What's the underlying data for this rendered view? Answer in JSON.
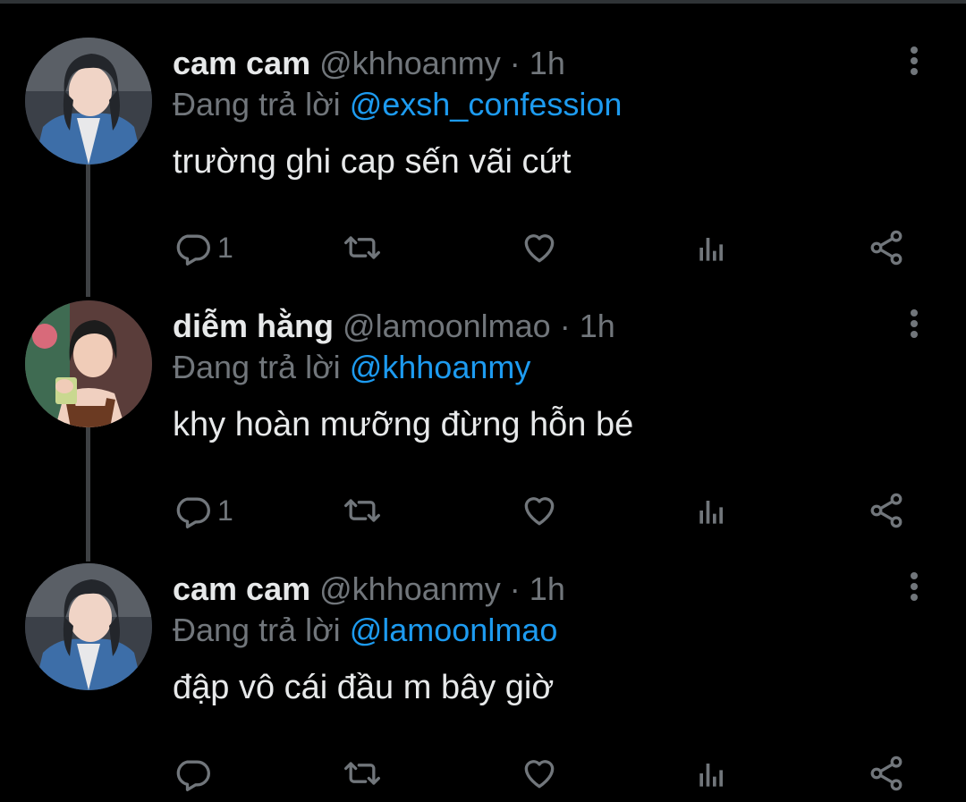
{
  "tweets": [
    {
      "name": "cam cam",
      "handle": "@khhoanmy",
      "dot": "·",
      "time": "1h",
      "reply_prefix": "Đang trả lời",
      "reply_to": "@exsh_confession",
      "text": "trường ghi cap sến vãi cứt",
      "reply_count": "1"
    },
    {
      "name": "diễm hằng",
      "handle": "@lamoonlmao",
      "dot": "·",
      "time": "1h",
      "reply_prefix": "Đang trả lời",
      "reply_to": "@khhoanmy",
      "text": "khy hoàn mưỡng đừng hỗn bé",
      "reply_count": "1"
    },
    {
      "name": "cam cam",
      "handle": "@khhoanmy",
      "dot": "·",
      "time": "1h",
      "reply_prefix": "Đang trả lời",
      "reply_to": "@lamoonlmao",
      "text": "đập vô cái đầu m bây giờ",
      "reply_count": ""
    }
  ],
  "icons": {
    "reply": "speech-bubble-icon",
    "retweet": "retweet-icon",
    "like": "heart-icon",
    "views": "bar-chart-icon",
    "share": "share-icon",
    "more": "more-vertical-icon"
  },
  "colors": {
    "background": "#000000",
    "text": "#e7e9ea",
    "muted": "#71767b",
    "mention": "#1d9bf0",
    "thread_line": "#3e4144"
  }
}
